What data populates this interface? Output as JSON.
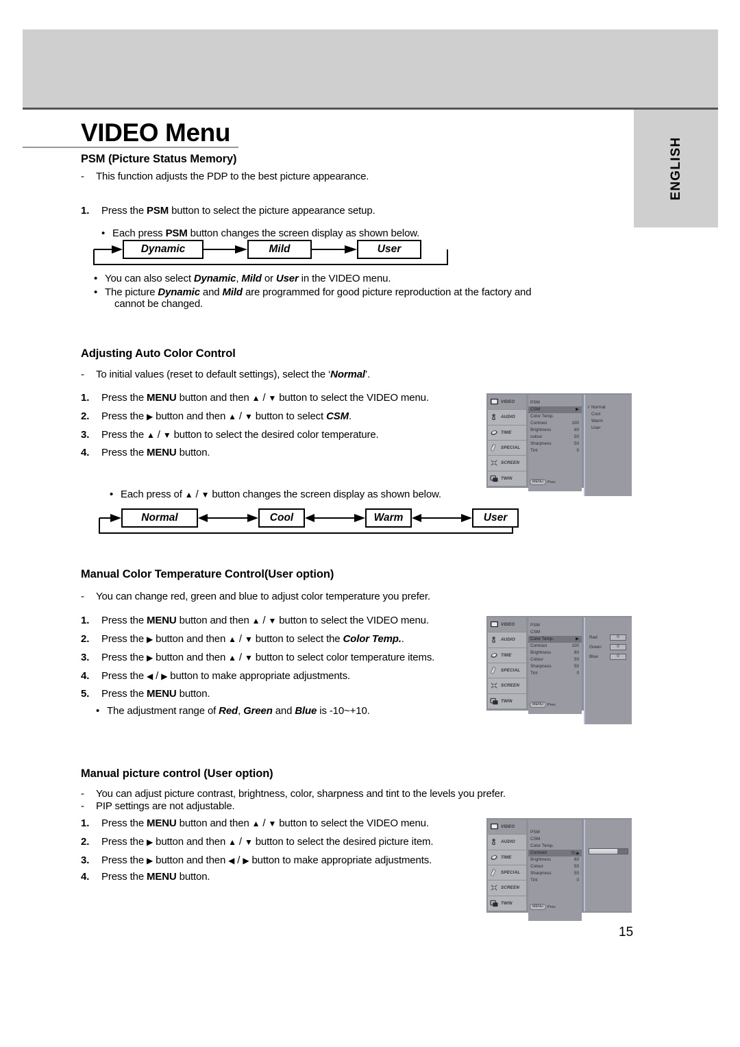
{
  "page": {
    "title": "VIDEO Menu",
    "language_tab": "ENGLISH",
    "page_number": "15"
  },
  "section_psm": {
    "heading": "PSM (Picture Status Memory)",
    "dash1": "This function adjusts the PDP to the best picture appearance.",
    "step1": "Press the PSM button to select the picture appearance setup.",
    "bullet1": "Each press PSM button changes the screen display as shown below.",
    "flow": [
      "Dynamic",
      "Mild",
      "User"
    ],
    "bullet2": "You can also select Dynamic, Mild or User in the VIDEO menu.",
    "bullet3_a": "The picture Dynamic and Mild are programmed for good picture reproduction at the factory and",
    "bullet3_b": "cannot be changed."
  },
  "section_auto_color": {
    "heading": "Adjusting Auto Color Control",
    "dash1": "To initial values (reset to default settings), select the ‘Normal’.",
    "steps": [
      "Press the MENU button and then ▲ / ▼ button to select the VIDEO menu.",
      "Press the ▶ button and then ▲ / ▼ button to select CSM.",
      "Press the ▲ / ▼ button to select the desired color temperature.",
      "Press the MENU button."
    ],
    "bullet1": "Each press of ▲ / ▼ button changes the screen display as shown below.",
    "flow": [
      "Normal",
      "Cool",
      "Warm",
      "User"
    ]
  },
  "section_manual_color": {
    "heading": "Manual Color Temperature Control(User option)",
    "dash1": "You can change red, green and blue to adjust color temperature you prefer.",
    "steps": [
      "Press the MENU button and then ▲ / ▼ button to select the VIDEO menu.",
      "Press the ▶ button and then ▲ / ▼ button to select the Color Temp..",
      "Press the ▶ button and then ▲ / ▼ button to select color temperature items.",
      "Press the ◀ / ▶ button to make appropriate adjustments.",
      "Press the MENU button."
    ],
    "bullet1": "The adjustment range of Red, Green and Blue is -10~+10."
  },
  "section_manual_picture": {
    "heading": "Manual picture control (User option)",
    "dash1": "You can adjust picture contrast, brightness, color, sharpness and tint to the levels you prefer.",
    "dash2": "PIP settings are not adjustable.",
    "steps": [
      "Press the MENU button and then ▲ / ▼ button to select the VIDEO menu.",
      "Press the ▶ button and then ▲ / ▼ button to select the desired picture item.",
      "Press the ▶ button and then ◀ / ▶ button to make appropriate adjustments.",
      "Press the MENU button."
    ]
  },
  "osd_common": {
    "sidebar": [
      "VIDEO",
      "AUDIO",
      "TIME",
      "SPECIAL",
      "SCREEN",
      "TWIN"
    ],
    "footer_button": "MENU",
    "footer_label": "Prev."
  },
  "osd1": {
    "rows": [
      {
        "label": "PSM",
        "value": ""
      },
      {
        "label": "CSM",
        "value": "",
        "highlight": true,
        "arrow": true
      },
      {
        "label": "Color Temp.",
        "value": ""
      },
      {
        "label": "Contrast",
        "value": "100"
      },
      {
        "label": "Brightness",
        "value": "60"
      },
      {
        "label": "colour",
        "value": "50"
      },
      {
        "label": "Sharpness",
        "value": "50"
      },
      {
        "label": "Tint",
        "value": "0"
      }
    ],
    "options": [
      "Normal",
      "Cool",
      "Warm",
      "User"
    ],
    "checked_option": "Normal",
    "check_glyph": "√"
  },
  "osd2": {
    "rows": [
      {
        "label": "PSM",
        "value": ""
      },
      {
        "label": "CSM",
        "value": ""
      },
      {
        "label": "Color Temp.",
        "value": "",
        "highlight": true,
        "arrow": true
      },
      {
        "label": "Contrast",
        "value": "100"
      },
      {
        "label": "Brightness",
        "value": "60"
      },
      {
        "label": "Colour",
        "value": "50"
      },
      {
        "label": "Sharpness",
        "value": "50"
      },
      {
        "label": "Tint",
        "value": "0"
      }
    ],
    "rgb": [
      {
        "label": "Red",
        "value": "0"
      },
      {
        "label": "Green",
        "value": "0"
      },
      {
        "label": "Blue",
        "value": "0"
      }
    ]
  },
  "osd3": {
    "rows": [
      {
        "label": "PSM",
        "value": ""
      },
      {
        "label": "CSM",
        "value": ""
      },
      {
        "label": "Color Temp.",
        "value": ""
      },
      {
        "label": "Contrast",
        "value": "70",
        "highlight": true,
        "arrow": true
      },
      {
        "label": "Brightness",
        "value": "60"
      },
      {
        "label": "Colour",
        "value": "50"
      },
      {
        "label": "Sharpness",
        "value": "50"
      },
      {
        "label": "Tint",
        "value": "0"
      }
    ],
    "slider_percent": 74
  },
  "colors": {
    "band": "#cfcfcf",
    "osd_bg": "#8d8f96",
    "osd_panel": "#9a9ba2",
    "osd_side": "#b3b4ba",
    "osd_highlight": "#76777e"
  }
}
